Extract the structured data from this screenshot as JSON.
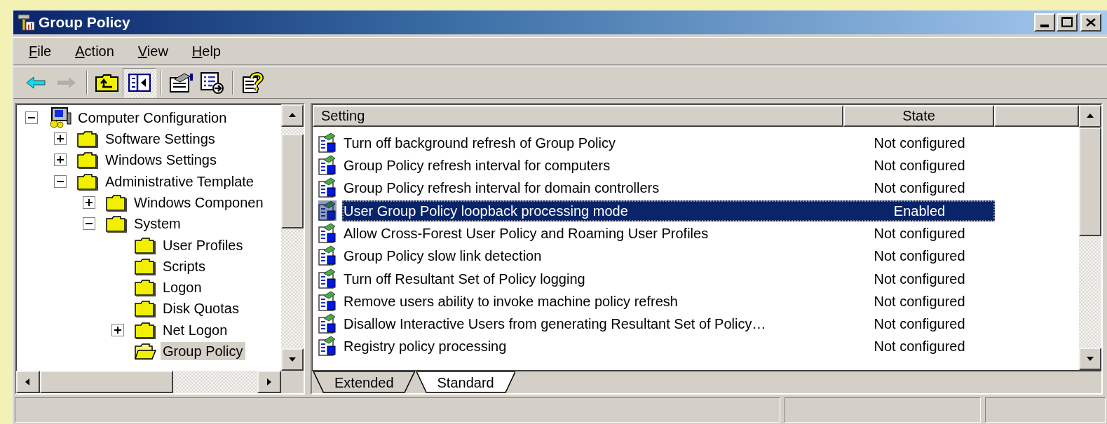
{
  "window": {
    "title": "Group Policy"
  },
  "menu": [
    "File",
    "Action",
    "View",
    "Help"
  ],
  "toolbar": [
    {
      "disabled": false,
      "pressed": false
    },
    {
      "disabled": true,
      "pressed": false
    },
    {
      "disabled": false,
      "pressed": false
    },
    {
      "disabled": false,
      "pressed": true
    },
    {
      "disabled": false,
      "pressed": false
    },
    {
      "disabled": false,
      "pressed": false
    },
    {
      "disabled": false,
      "pressed": false
    }
  ],
  "tree": [
    {
      "label": "Computer Configuration",
      "expanded": true,
      "selected": false,
      "children": [
        {
          "label": "Software Settings",
          "expanded": false,
          "selected": false
        },
        {
          "label": "Windows Settings",
          "expanded": false,
          "selected": false
        },
        {
          "label": "Administrative Template",
          "expanded": true,
          "selected": false,
          "children": [
            {
              "label": "Windows Componen",
              "expanded": false,
              "selected": false
            },
            {
              "label": "System",
              "expanded": true,
              "selected": false,
              "children": [
                {
                  "label": "User Profiles",
                  "selected": false
                },
                {
                  "label": "Scripts",
                  "selected": false
                },
                {
                  "label": "Logon",
                  "selected": false
                },
                {
                  "label": "Disk Quotas",
                  "selected": false
                },
                {
                  "label": "Net Logon",
                  "expanded": false,
                  "selected": false
                },
                {
                  "label": "Group Policy",
                  "selected": true
                }
              ]
            }
          ]
        }
      ]
    }
  ],
  "table": {
    "columns": [
      "Setting",
      "State"
    ],
    "rows": [
      {
        "setting": "Turn off background refresh of Group Policy",
        "state": "Not configured",
        "selected": false
      },
      {
        "setting": "Group Policy refresh interval for computers",
        "state": "Not configured",
        "selected": false
      },
      {
        "setting": "Group Policy refresh interval for domain controllers",
        "state": "Not configured",
        "selected": false
      },
      {
        "setting": "User Group Policy loopback processing mode",
        "state": "Enabled",
        "selected": true
      },
      {
        "setting": "Allow Cross-Forest User Policy and Roaming User Profiles",
        "state": "Not configured",
        "selected": false
      },
      {
        "setting": "Group Policy slow link detection",
        "state": "Not configured",
        "selected": false
      },
      {
        "setting": "Turn off Resultant Set of Policy logging",
        "state": "Not configured",
        "selected": false
      },
      {
        "setting": "Remove users ability to invoke machine policy refresh",
        "state": "Not configured",
        "selected": false
      },
      {
        "setting": "Disallow Interactive Users from generating Resultant Set of Policy…",
        "state": "Not configured",
        "selected": false
      },
      {
        "setting": "Registry policy processing",
        "state": "Not configured",
        "selected": false
      }
    ]
  },
  "tabs": [
    {
      "label": "Extended",
      "selected": false
    },
    {
      "label": "Standard",
      "selected": true
    }
  ]
}
